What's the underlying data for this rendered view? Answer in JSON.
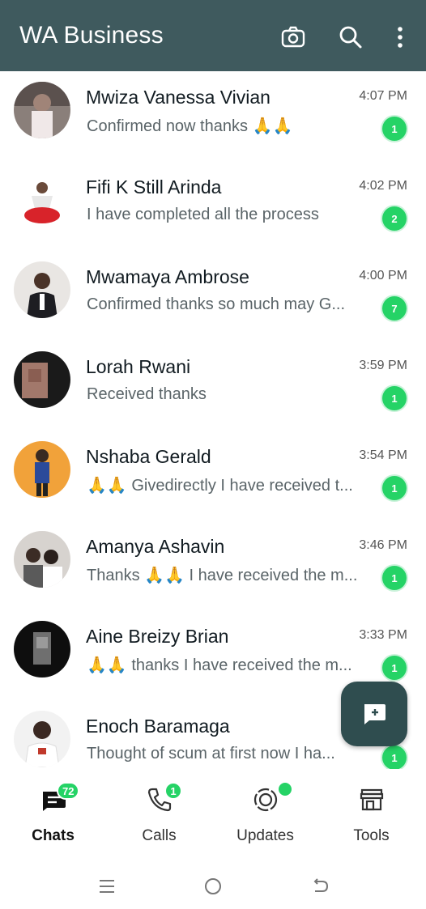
{
  "header": {
    "title": "WA Business",
    "icons": [
      "camera-icon",
      "search-icon",
      "more-vert-icon"
    ],
    "color": "#3f5a5e"
  },
  "chats": [
    {
      "name": "Mwiza Vanessa Vivian",
      "time": "4:07 PM",
      "preview": "Confirmed now thanks 🙏🙏",
      "unread": "1"
    },
    {
      "name": "Fifi K Still Arinda",
      "time": "4:02 PM",
      "preview": "I have completed all the process",
      "unread": "2"
    },
    {
      "name": "Mwamaya Ambrose",
      "time": "4:00 PM",
      "preview": "Confirmed thanks so much may G...",
      "unread": "7"
    },
    {
      "name": "Lorah Rwani",
      "time": "3:59 PM",
      "preview": "Received thanks",
      "unread": "1"
    },
    {
      "name": "Nshaba Gerald",
      "time": "3:54 PM",
      "preview": "🙏🙏 Givedirectly I have received t...",
      "unread": "1"
    },
    {
      "name": "Amanya Ashavin",
      "time": "3:46 PM",
      "preview": "Thanks 🙏🙏 I have received the m...",
      "unread": "1"
    },
    {
      "name": "Aine Breizy Brian",
      "time": "3:33 PM",
      "preview": "🙏🙏 thanks I have received the m...",
      "unread": "1"
    },
    {
      "name": "Enoch Baramaga",
      "time": "",
      "preview": "Thought of scum at first now I ha...",
      "unread": "1"
    }
  ],
  "fab": {
    "icon": "new-chat-icon"
  },
  "bottom_nav": {
    "chats": {
      "label": "Chats",
      "badge": "72"
    },
    "calls": {
      "label": "Calls",
      "badge": "1"
    },
    "updates": {
      "label": "Updates"
    },
    "tools": {
      "label": "Tools"
    }
  },
  "colors": {
    "accent": "#25d366",
    "header": "#3f5a5e",
    "fab": "#2f4d4f"
  }
}
